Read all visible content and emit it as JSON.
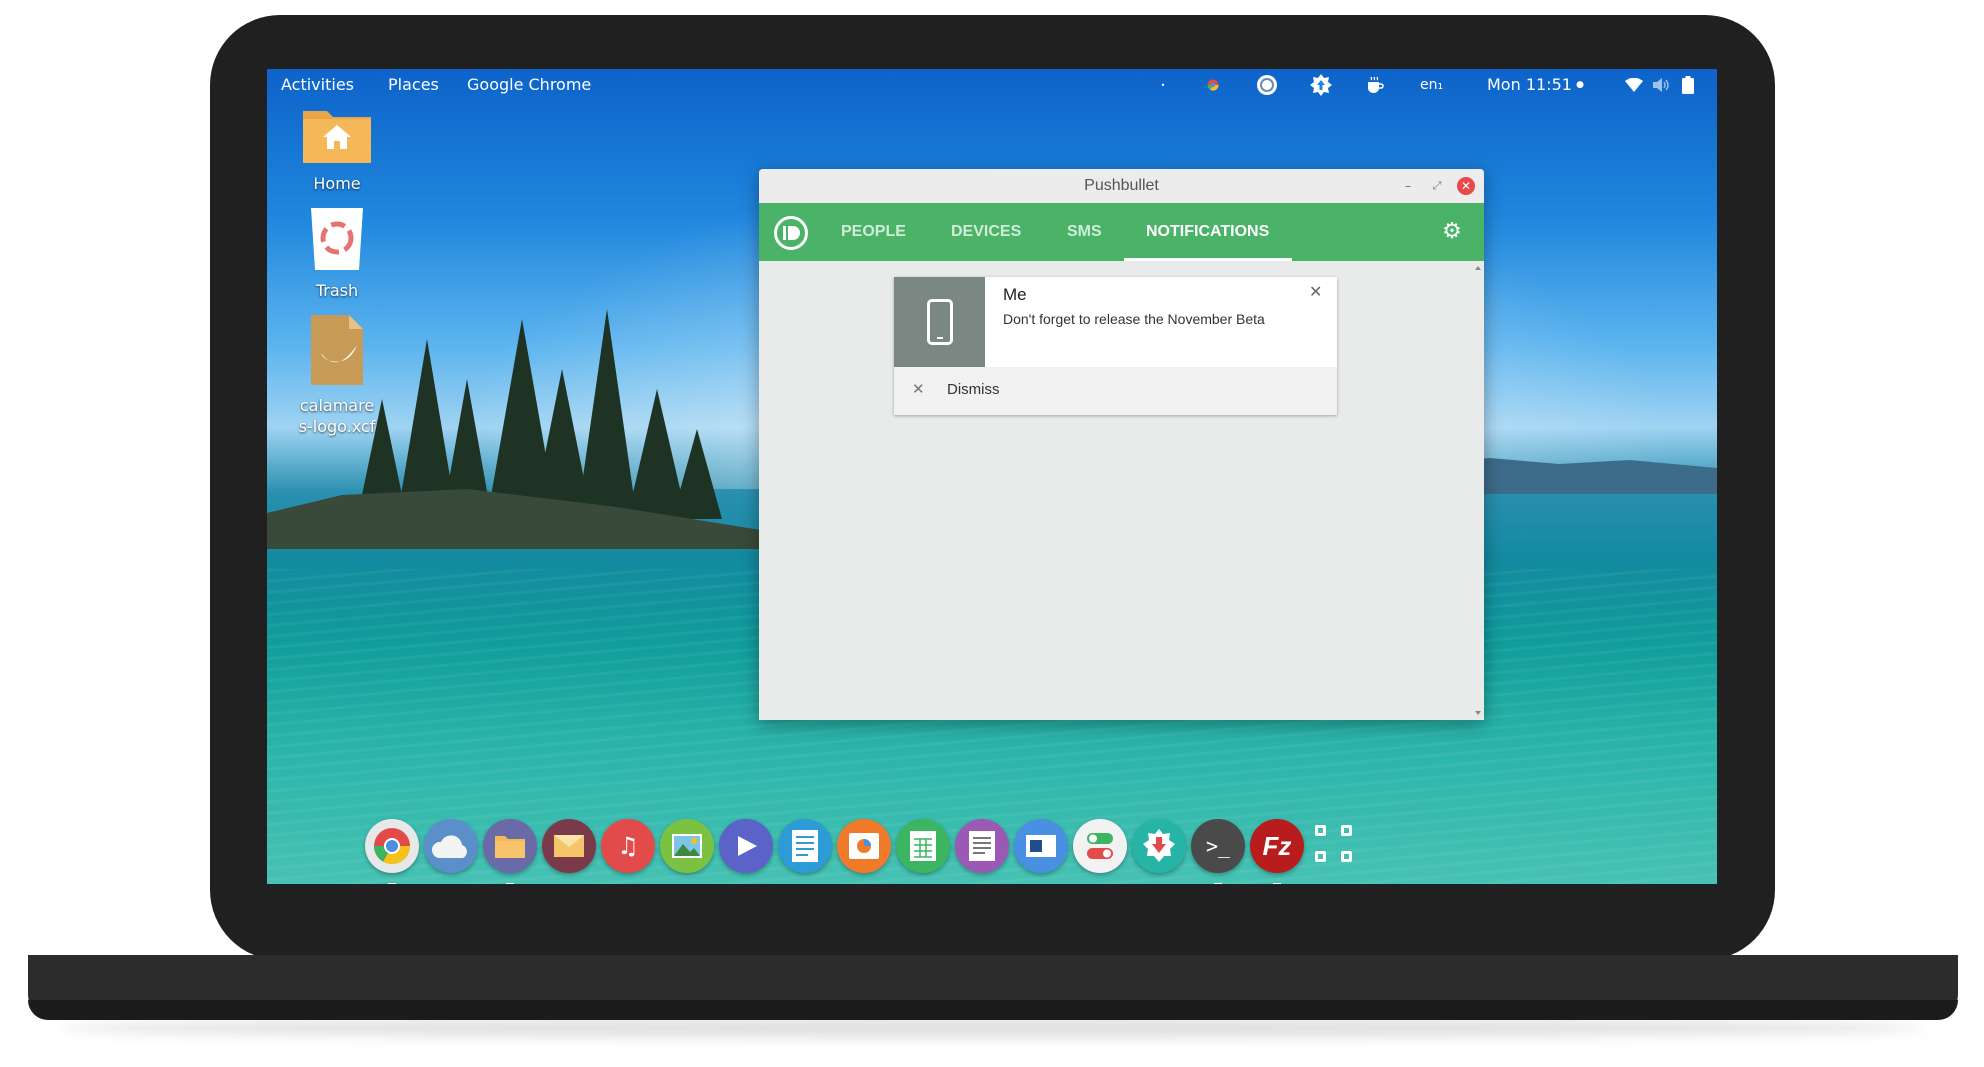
{
  "topbar": {
    "activities": "Activities",
    "places": "Places",
    "app_name": "Google Chrome",
    "keyboard_layout": "en₁",
    "clock": "Mon 11:51"
  },
  "desktop": {
    "icons": [
      {
        "label": "Home",
        "icon": "home-folder-icon"
      },
      {
        "label": "Trash",
        "icon": "trash-icon"
      },
      {
        "label": "calamares-logo.xcf",
        "icon": "xcf-file-icon"
      }
    ]
  },
  "window": {
    "title": "Pushbullet",
    "tabs": [
      "PEOPLE",
      "DEVICES",
      "SMS",
      "NOTIFICATIONS"
    ],
    "active_tab": "NOTIFICATIONS",
    "notification": {
      "title": "Me",
      "body": "Don't forget to release the November Beta",
      "dismiss_label": "Dismiss"
    }
  },
  "dock": {
    "apps": [
      {
        "name": "chrome-icon",
        "color": "#e8e8e8"
      },
      {
        "name": "weather-icon",
        "color": "#5b8fc9"
      },
      {
        "name": "files-icon",
        "color": "#6a6aa8"
      },
      {
        "name": "mail-icon",
        "color": "#7a3a4a"
      },
      {
        "name": "music-icon",
        "color": "#e34b4b"
      },
      {
        "name": "photos-icon",
        "color": "#7cc242"
      },
      {
        "name": "video-icon",
        "color": "#5b62c8"
      },
      {
        "name": "document-icon",
        "color": "#2e9bd6"
      },
      {
        "name": "screenshot-icon",
        "color": "#f07a2a"
      },
      {
        "name": "spreadsheet-icon",
        "color": "#3bb562"
      },
      {
        "name": "text-editor-icon",
        "color": "#9b59b6"
      },
      {
        "name": "presentation-icon",
        "color": "#4a90e2"
      },
      {
        "name": "settings-toggle-icon",
        "color": "#f2f2f2"
      },
      {
        "name": "software-center-icon",
        "color": "#26b4a6"
      },
      {
        "name": "terminal-icon",
        "color": "#4a4a4a"
      },
      {
        "name": "filezilla-icon",
        "color": "#b91c1c"
      },
      {
        "name": "app-grid-icon",
        "color": "#ffffff"
      }
    ]
  }
}
